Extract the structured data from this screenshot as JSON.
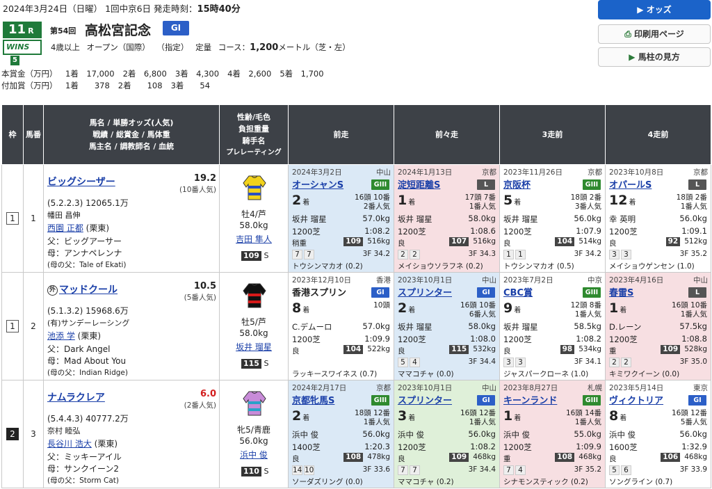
{
  "header": {
    "date_info": "2024年3月24日（日曜）  1回中京6日   発走時刻：",
    "post_time": "15時40分",
    "race_number": "11",
    "race_suffix": "R",
    "wins_logo": "WINS",
    "wins_number": "5",
    "kai": "第54回",
    "race_name": "高松宮記念",
    "grade": "GI",
    "conditions": "4歳以上  オープン（国際） （指定）  定量  コース：",
    "distance": "1,200",
    "course_suffix": "メートル（芝・左）"
  },
  "buttons": {
    "odds": "オッズ",
    "print": "印刷用ページ",
    "guide": "馬柱の見方"
  },
  "prize": {
    "main_label": "本賞金（万円）",
    "main": [
      "1着　17,000",
      "2着　6,800",
      "3着　4,300",
      "4着　2,600",
      "5着　1,700"
    ],
    "extra_label": "付加賞（万円）",
    "extra": [
      "1着　　378",
      "2着　　108",
      "3着　　54"
    ]
  },
  "columns": {
    "waku": "枠",
    "umaban": "馬番",
    "horse_h1": "馬名 / 単勝オッズ(人気)",
    "horse_h2": "戦績 / 総賞金 / 馬体重",
    "horse_h3": "馬主名 / 調教師名 / 血統",
    "jockey_h1": "性齢/毛色",
    "jockey_h2": "負担重量",
    "jockey_h3": "騎手名",
    "jockey_h4": "プレレーティング",
    "p1": "前走",
    "p2": "前々走",
    "p3": "3走前",
    "p4": "4走前"
  },
  "colors": {
    "header_bg": "#3d4147",
    "blue": "#dbe9f6",
    "pink": "#f7dfe2",
    "green": "#dff0d9"
  },
  "horses": [
    {
      "waku": "1",
      "umaban": "1",
      "mark": "",
      "name": "ビッグシーザー",
      "odds": "19.2",
      "popularity": "(10番人気)",
      "record": "(5.2.2.3)  12065.1万",
      "owner": "幡田 昌伸",
      "trainer": "西園 正都",
      "stable": "(栗東)",
      "sire": "父：ビッグアーサー",
      "dam": "母：アンナペレンナ",
      "damsire": "(母の父：Tale of Ekati)",
      "sex_age": "牡4/芦",
      "weight": "58.0kg",
      "jockey": "吉田 隼人",
      "rating": "109",
      "rating_mark": "S",
      "silk": [
        "#f2d21b",
        "#2a4fc2"
      ],
      "past": [
        {
          "color": "blue",
          "date": "2024年3月2日",
          "venue": "中山",
          "race": "オーシャンS",
          "grade": "GIII",
          "place": "2",
          "place_suffix": "着",
          "field": "16頭 10番",
          "pop": "2番人気",
          "jockey": "坂井 瑠星",
          "wt": "57.0kg",
          "dist": "1200芝",
          "time": "1:08.2",
          "cond": "稍重",
          "bno": "109",
          "bw": "516kg",
          "pos": [
            "7",
            "7"
          ],
          "f3": "3F 34.2",
          "winner": "トウシンマカオ (0.2)"
        },
        {
          "color": "pink",
          "date": "2024年1月13日",
          "venue": "京都",
          "race": "淀短距離S",
          "grade": "L",
          "place": "1",
          "place_suffix": "着",
          "field": "17頭 7番",
          "pop": "1番人気",
          "jockey": "坂井 瑠星",
          "wt": "58.0kg",
          "dist": "1200芝",
          "time": "1:08.6",
          "cond": "良",
          "bno": "107",
          "bw": "516kg",
          "pos": [
            "2",
            "2"
          ],
          "f3": "3F 34.3",
          "winner": "メイショウソラフネ (0.2)"
        },
        {
          "color": "white",
          "date": "2023年11月26日",
          "venue": "京都",
          "race": "京阪杯",
          "grade": "GIII",
          "place": "5",
          "place_suffix": "着",
          "field": "18頭 2番",
          "pop": "3番人気",
          "jockey": "坂井 瑠星",
          "wt": "56.0kg",
          "dist": "1200芝",
          "time": "1:07.9",
          "cond": "良",
          "bno": "104",
          "bw": "514kg",
          "pos": [
            "1",
            "1"
          ],
          "f3": "3F 34.2",
          "winner": "トウシンマカオ (0.5)"
        },
        {
          "color": "white",
          "date": "2023年10月8日",
          "venue": "京都",
          "race": "オパールS",
          "grade": "L",
          "place": "12",
          "place_suffix": "着",
          "field": "18頭 2番",
          "pop": "1番人気",
          "jockey": "幸 英明",
          "wt": "56.0kg",
          "dist": "1200芝",
          "time": "1:09.1",
          "cond": "良",
          "bno": "92",
          "bw": "512kg",
          "pos": [
            "3",
            "3"
          ],
          "f3": "3F 35.2",
          "winner": "メイショウゲンセン (1.0)"
        }
      ]
    },
    {
      "waku": "1",
      "umaban": "2",
      "mark": "外",
      "name": "マッドクール",
      "odds": "10.5",
      "popularity": "(5番人気)",
      "record": "(5.1.3.2)  15968.6万",
      "owner": "(有)サンデーレーシング",
      "trainer": "池添 学",
      "stable": "(栗東)",
      "sire": "父：Dark Angel",
      "dam": "母：Mad About You",
      "damsire": "(母の父：Indian Ridge)",
      "sex_age": "牡5/芦",
      "weight": "58.0kg",
      "jockey": "坂井 瑠星",
      "rating": "115",
      "rating_mark": "S",
      "silk": [
        "#111111",
        "#d61a1a"
      ],
      "past": [
        {
          "color": "white",
          "date": "2023年12月10日",
          "venue": "香港",
          "race": "香港スプリン",
          "grade": "GI",
          "place": "8",
          "place_suffix": "着",
          "field": "",
          "pop": "10頭",
          "jockey": "C.デムーロ",
          "wt": "57.0kg",
          "dist": "1200芝",
          "time": "1:09.9",
          "cond": "良",
          "bno": "104",
          "bw": "522kg",
          "pos": [],
          "f3": "",
          "winner": "ラッキースワイネス (0.7)",
          "plain": true
        },
        {
          "color": "blue",
          "date": "2023年10月1日",
          "venue": "中山",
          "race": "スプリンター",
          "grade": "GI",
          "place": "2",
          "place_suffix": "着",
          "field": "16頭 10番",
          "pop": "6番人気",
          "jockey": "坂井 瑠星",
          "wt": "58.0kg",
          "dist": "1200芝",
          "time": "1:08.0",
          "cond": "良",
          "bno": "115",
          "bw": "532kg",
          "pos": [
            "5",
            "4"
          ],
          "f3": "3F 34.4",
          "winner": "ママコチャ (0.0)"
        },
        {
          "color": "white",
          "date": "2023年7月2日",
          "venue": "中京",
          "race": "CBC賞",
          "grade": "GIII",
          "place": "9",
          "place_suffix": "着",
          "field": "12頭 8番",
          "pop": "1番人気",
          "jockey": "坂井 瑠星",
          "wt": "58.5kg",
          "dist": "1200芝",
          "time": "1:08.2",
          "cond": "良",
          "bno": "98",
          "bw": "534kg",
          "pos": [
            "3",
            "3"
          ],
          "f3": "3F 34.1",
          "winner": "ジャスパークローネ (1.0)"
        },
        {
          "color": "pink",
          "date": "2023年4月16日",
          "venue": "中山",
          "race": "春雷S",
          "grade": "L",
          "place": "1",
          "place_suffix": "着",
          "field": "16頭 10番",
          "pop": "1番人気",
          "jockey": "D.レーン",
          "wt": "57.5kg",
          "dist": "1200芝",
          "time": "1:08.8",
          "cond": "重",
          "bno": "109",
          "bw": "528kg",
          "pos": [
            "2",
            "2"
          ],
          "f3": "3F 35.0",
          "winner": "キミワクイーン (0.0)"
        }
      ]
    },
    {
      "waku": "2",
      "umaban": "3",
      "mark": "",
      "name": "ナムラクレア",
      "odds": "6.0",
      "popularity": "(2番人気)",
      "record": "(5.4.4.3)  40777.2万",
      "owner": "奈村 睦弘",
      "trainer": "長谷川 浩大",
      "stable": "(栗東)",
      "sire": "父：ミッキーアイル",
      "dam": "母：サンクイーン2",
      "damsire": "(母の父：Storm Cat)",
      "sex_age": "牝5/青鹿",
      "weight": "56.0kg",
      "jockey": "浜中 俊",
      "rating": "110",
      "rating_mark": "S",
      "silk": [
        "#c88bd8",
        "#2aa1c9"
      ],
      "past": [
        {
          "color": "blue",
          "date": "2024年2月17日",
          "venue": "京都",
          "race": "京都牝馬S",
          "grade": "GIII",
          "place": "2",
          "place_suffix": "着",
          "field": "18頭 12番",
          "pop": "1番人気",
          "jockey": "浜中 俊",
          "wt": "56.0kg",
          "dist": "1400芝",
          "time": "1:20.3",
          "cond": "良",
          "bno": "108",
          "bw": "478kg",
          "pos": [
            "14",
            "10"
          ],
          "f3": "3F 33.6",
          "winner": "ソーダズリング (0.0)"
        },
        {
          "color": "green",
          "date": "2023年10月1日",
          "venue": "中山",
          "race": "スプリンター",
          "grade": "GI",
          "place": "3",
          "place_suffix": "着",
          "field": "16頭 12番",
          "pop": "1番人気",
          "jockey": "浜中 俊",
          "wt": "56.0kg",
          "dist": "1200芝",
          "time": "1:08.2",
          "cond": "良",
          "bno": "109",
          "bw": "468kg",
          "pos": [
            "7",
            "7"
          ],
          "f3": "3F 34.4",
          "winner": "ママコチャ (0.2)"
        },
        {
          "color": "pink",
          "date": "2023年8月27日",
          "venue": "札幌",
          "race": "キーンランド",
          "grade": "GIII",
          "place": "1",
          "place_suffix": "着",
          "field": "16頭 14番",
          "pop": "1番人気",
          "jockey": "浜中 俊",
          "wt": "55.0kg",
          "dist": "1200芝",
          "time": "1:09.9",
          "cond": "重",
          "bno": "108",
          "bw": "468kg",
          "pos": [
            "7",
            "4"
          ],
          "f3": "3F 35.2",
          "winner": "シナモンスティック (0.2)"
        },
        {
          "color": "white",
          "date": "2023年5月14日",
          "venue": "東京",
          "race": "ヴィクトリア",
          "grade": "GI",
          "place": "8",
          "place_suffix": "着",
          "field": "16頭 12番",
          "pop": "5番人気",
          "jockey": "浜中 俊",
          "wt": "56.0kg",
          "dist": "1600芝",
          "time": "1:32.9",
          "cond": "良",
          "bno": "106",
          "bw": "468kg",
          "pos": [
            "5",
            "6"
          ],
          "f3": "3F 33.9",
          "winner": "ソングライン (0.7)"
        }
      ]
    }
  ]
}
